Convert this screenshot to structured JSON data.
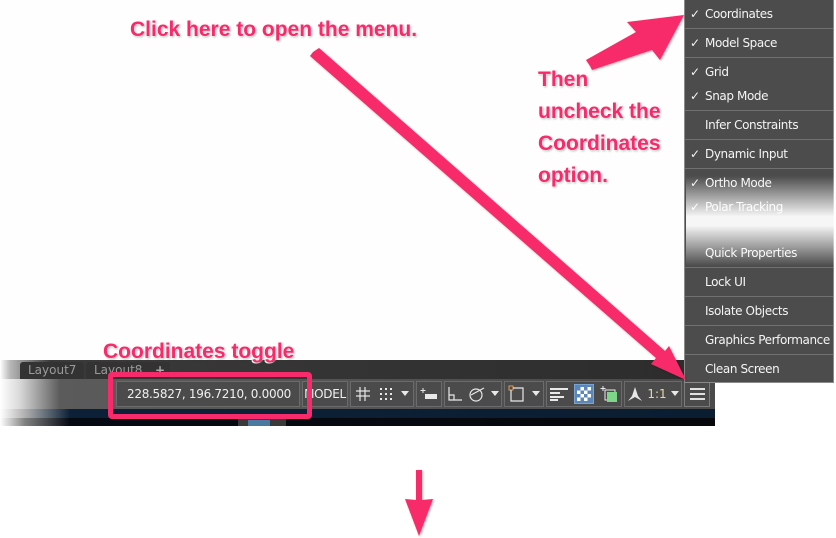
{
  "annotations": {
    "click_here": "Click here to open the menu.",
    "then_uncheck": [
      "Then",
      "uncheck the",
      "Coordinates",
      "option."
    ],
    "coords_toggle": "Coordinates toggle",
    "accent_color": "#f72a6b"
  },
  "layout_tabs": [
    {
      "label": "Layout7"
    },
    {
      "label": "Layout8"
    },
    {
      "label": "+"
    }
  ],
  "statusbar": {
    "coordinates": "228.5827, 196.7210, 0.0000",
    "model_label": "MODEL",
    "icons": [
      "grid-icon",
      "snap-dots-icon",
      "dropdown-icon",
      "infer-constraints-icon",
      "ortho-icon",
      "polar-icon",
      "dropdown-icon",
      "isodraft-icon",
      "dropdown-icon",
      "lineweight-icon",
      "transparency-icon",
      "selection-cycling-icon",
      "annotation-icon"
    ],
    "scale_label": "1:1",
    "customization_menu_icon": "hamburger-icon"
  },
  "menu": {
    "items": [
      {
        "label": "Coordinates",
        "checked": true
      },
      {
        "label": "Model Space",
        "checked": true
      },
      {
        "label": "Grid",
        "checked": true
      },
      {
        "label": "Snap Mode",
        "checked": true
      },
      {
        "label": "Infer Constraints",
        "checked": false
      },
      {
        "label": "Dynamic Input",
        "checked": true
      },
      {
        "label": "Ortho Mode",
        "checked": true
      },
      {
        "label": "Polar Tracking",
        "checked": true
      },
      {
        "label": "Quick Properties",
        "checked": false
      },
      {
        "label": "Lock UI",
        "checked": false
      },
      {
        "label": "Isolate Objects",
        "checked": false
      },
      {
        "label": "Graphics Performance",
        "checked": false
      },
      {
        "label": "Clean Screen",
        "checked": false
      }
    ],
    "check_glyph": "✓"
  }
}
